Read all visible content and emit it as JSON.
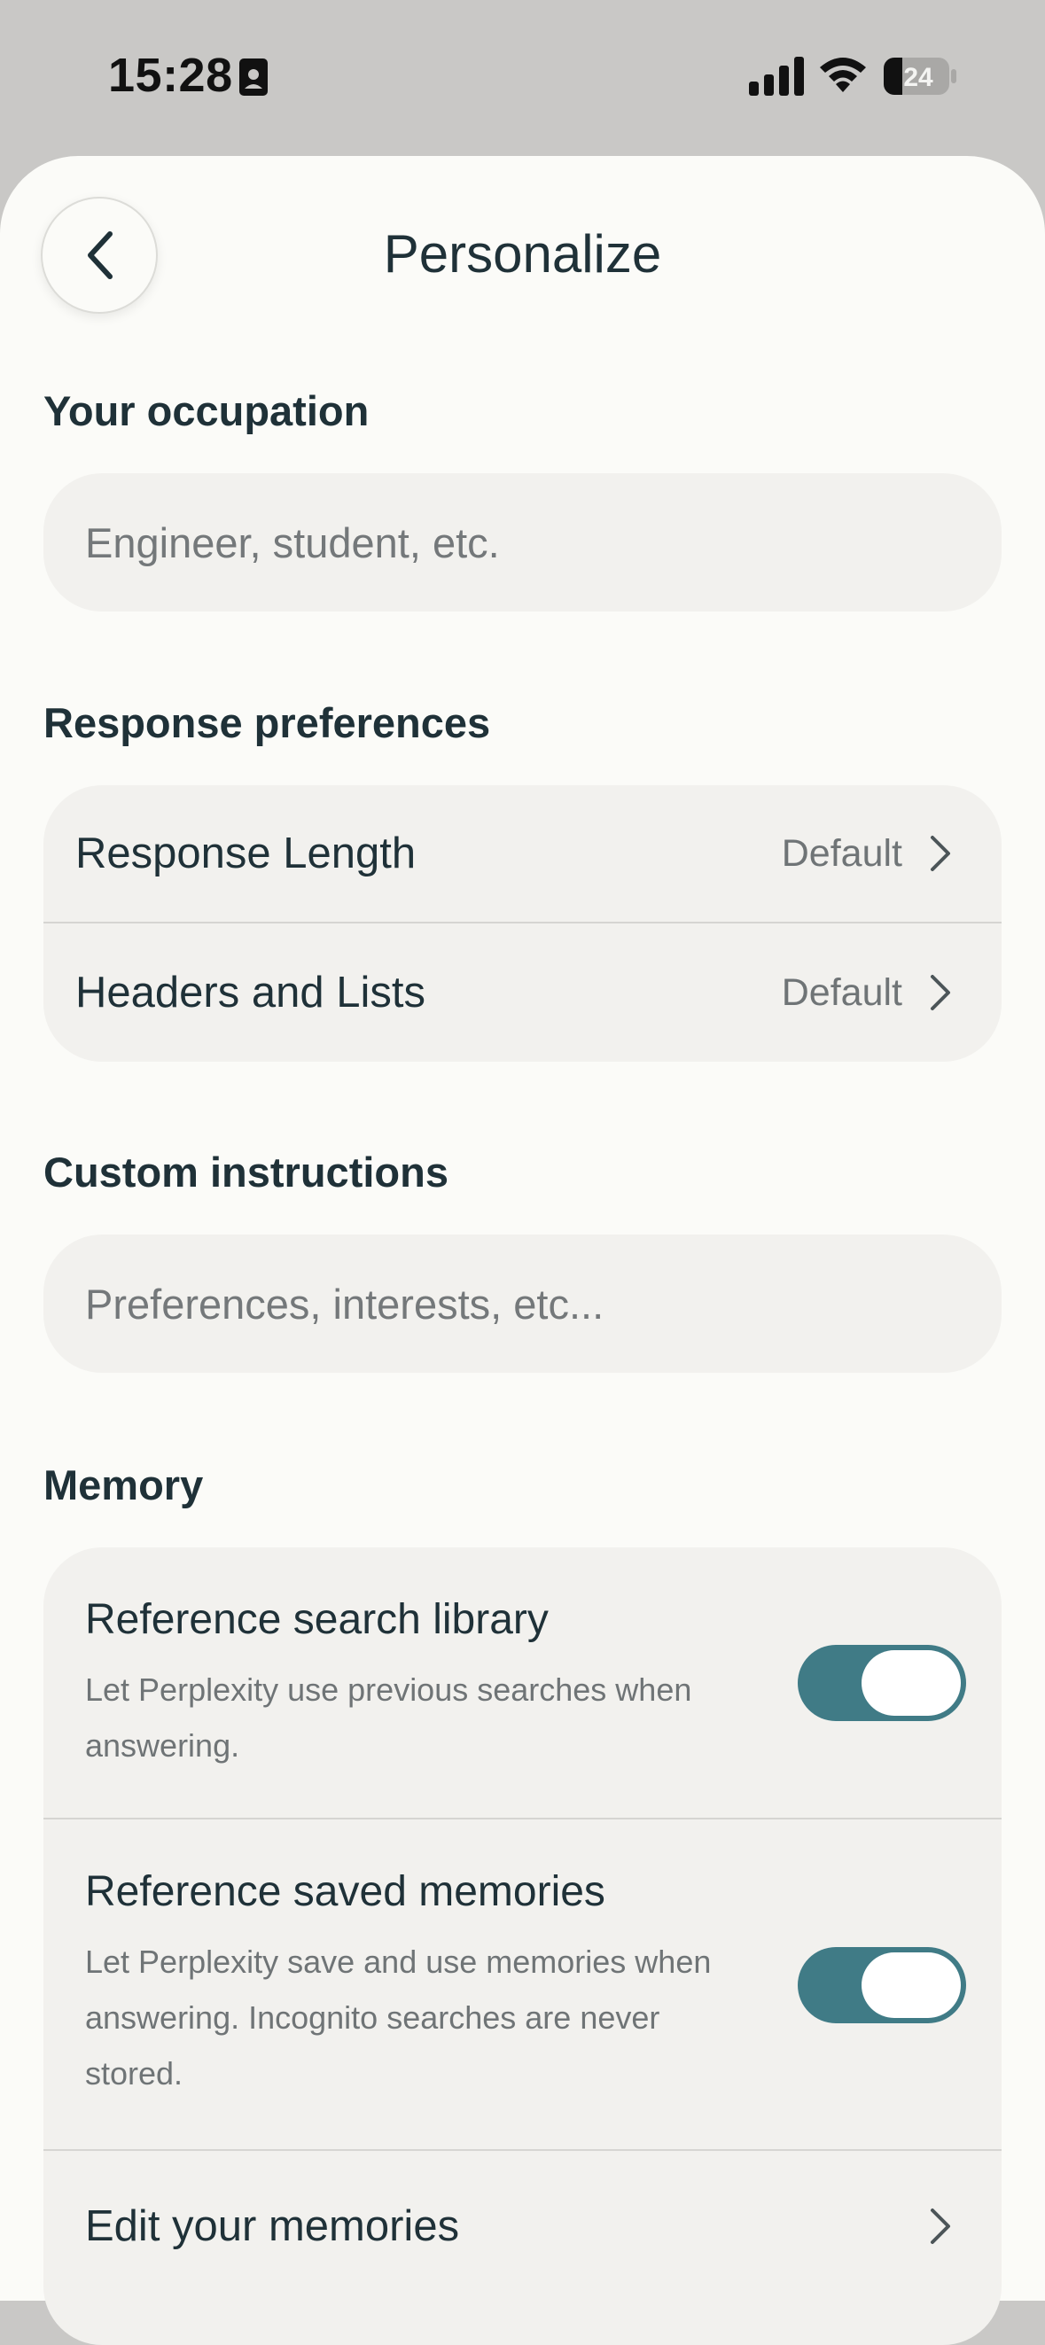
{
  "status_bar": {
    "time": "15:28",
    "battery": "24"
  },
  "header": {
    "title": "Personalize"
  },
  "occupation": {
    "label": "Your occupation",
    "placeholder": "Engineer, student, etc."
  },
  "response_preferences": {
    "label": "Response preferences",
    "rows": [
      {
        "label": "Response Length",
        "value": "Default"
      },
      {
        "label": "Headers and Lists",
        "value": "Default"
      }
    ]
  },
  "custom_instructions": {
    "label": "Custom instructions",
    "placeholder": "Preferences, interests, etc..."
  },
  "memory": {
    "label": "Memory",
    "items": [
      {
        "title": "Reference search library",
        "description": "Let Perplexity use previous searches when answering.",
        "enabled": true
      },
      {
        "title": "Reference saved memories",
        "description": "Let Perplexity save and use memories when answering. Incognito searches are never stored.",
        "enabled": true
      }
    ],
    "edit_label": "Edit your memories"
  },
  "colors": {
    "toggle_on": "#407b86",
    "sheet_bg": "#fbfbf8",
    "card_bg": "#f2f1ee",
    "text_primary": "#1f3138",
    "text_secondary": "#6f7476"
  }
}
